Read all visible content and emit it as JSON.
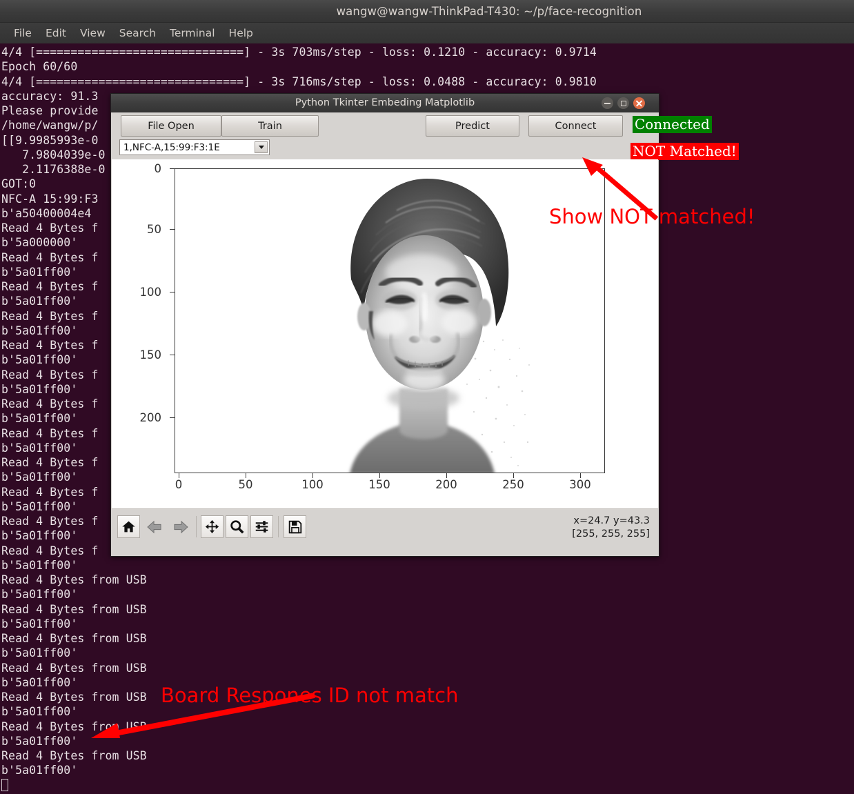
{
  "terminal": {
    "title": "wangw@wangw-ThinkPad-T430: ~/p/face-recognition",
    "menu": [
      "File",
      "Edit",
      "View",
      "Search",
      "Terminal",
      "Help"
    ],
    "lines": [
      "4/4 [==============================] - 3s 703ms/step - loss: 0.1210 - accuracy: 0.9714",
      "Epoch 60/60",
      "4/4 [==============================] - 3s 716ms/step - loss: 0.0488 - accuracy: 0.9810",
      "accuracy: 91.3",
      "Please provide",
      "/home/wangw/p/",
      "[[9.9985993e-0",
      "   7.9804039e-0",
      "   2.1176388e-0",
      "GOT:0",
      "NFC-A 15:99:F3",
      "b'a50400004e4",
      "Read 4 Bytes f",
      "b'5a000000'",
      "Read 4 Bytes f",
      "b'5a01ff00'",
      "Read 4 Bytes f",
      "b'5a01ff00'",
      "Read 4 Bytes f",
      "b'5a01ff00'",
      "Read 4 Bytes f",
      "b'5a01ff00'",
      "Read 4 Bytes f",
      "b'5a01ff00'",
      "Read 4 Bytes f",
      "b'5a01ff00'",
      "Read 4 Bytes f",
      "b'5a01ff00'",
      "Read 4 Bytes f",
      "b'5a01ff00'",
      "Read 4 Bytes f",
      "b'5a01ff00'",
      "Read 4 Bytes f",
      "b'5a01ff00'",
      "Read 4 Bytes f",
      "b'5a01ff00'",
      "Read 4 Bytes from USB",
      "b'5a01ff00'",
      "Read 4 Bytes from USB",
      "b'5a01ff00'",
      "Read 4 Bytes from USB",
      "b'5a01ff00'",
      "Read 4 Bytes from USB",
      "b'5a01ff00'",
      "Read 4 Bytes from USB",
      "b'5a01ff00'",
      "Read 4 Bytes from USB",
      "b'5a01ff00'",
      "Read 4 Bytes from USB",
      "b'5a01ff00'"
    ]
  },
  "tk_window": {
    "title": "Python Tkinter Embeding Matplotlib",
    "buttons": {
      "file_open": "File Open",
      "train": "Train",
      "predict": "Predict",
      "connect": "Connect"
    },
    "status": {
      "connection": "Connected",
      "connection_bg": "#008000",
      "match": "NOT Matched!",
      "match_bg": "#fe0000"
    },
    "combo": {
      "selected": "1,NFC-A,15:99:F3:1E"
    },
    "navtoolbar": {
      "icons": [
        "home-icon",
        "back-arrow-icon",
        "forward-arrow-icon",
        "pan-move-icon",
        "zoom-magnifier-icon",
        "subplot-sliders-icon",
        "save-floppy-icon"
      ],
      "coord_line1": "x=24.7 y=43.3",
      "coord_line2": "[255, 255, 255]"
    }
  },
  "chart_data": {
    "type": "heatmap",
    "title": "",
    "xlabel": "",
    "ylabel": "",
    "xticks": [
      0,
      50,
      100,
      150,
      200,
      250,
      300
    ],
    "yticks": [
      0,
      50,
      100,
      150,
      200
    ],
    "xlim": [
      0,
      320
    ],
    "ylim": [
      250,
      0
    ],
    "grid": false,
    "legend": "none",
    "description": "Grayscale face photograph rendered as an image plot (imshow), man smiling, facing camera",
    "colormap": "gray",
    "value_range": [
      0,
      255
    ],
    "hovered_pixel_value": [
      255,
      255,
      255
    ],
    "hovered_coords": {
      "x": 24.7,
      "y": 43.3
    }
  },
  "annotations": [
    {
      "id": "show-not-matched",
      "text": "Show NOT matched!",
      "color": "#ff0000"
    },
    {
      "id": "board-respones",
      "text": "Board Respones ID not match",
      "color": "#ff0000"
    }
  ]
}
